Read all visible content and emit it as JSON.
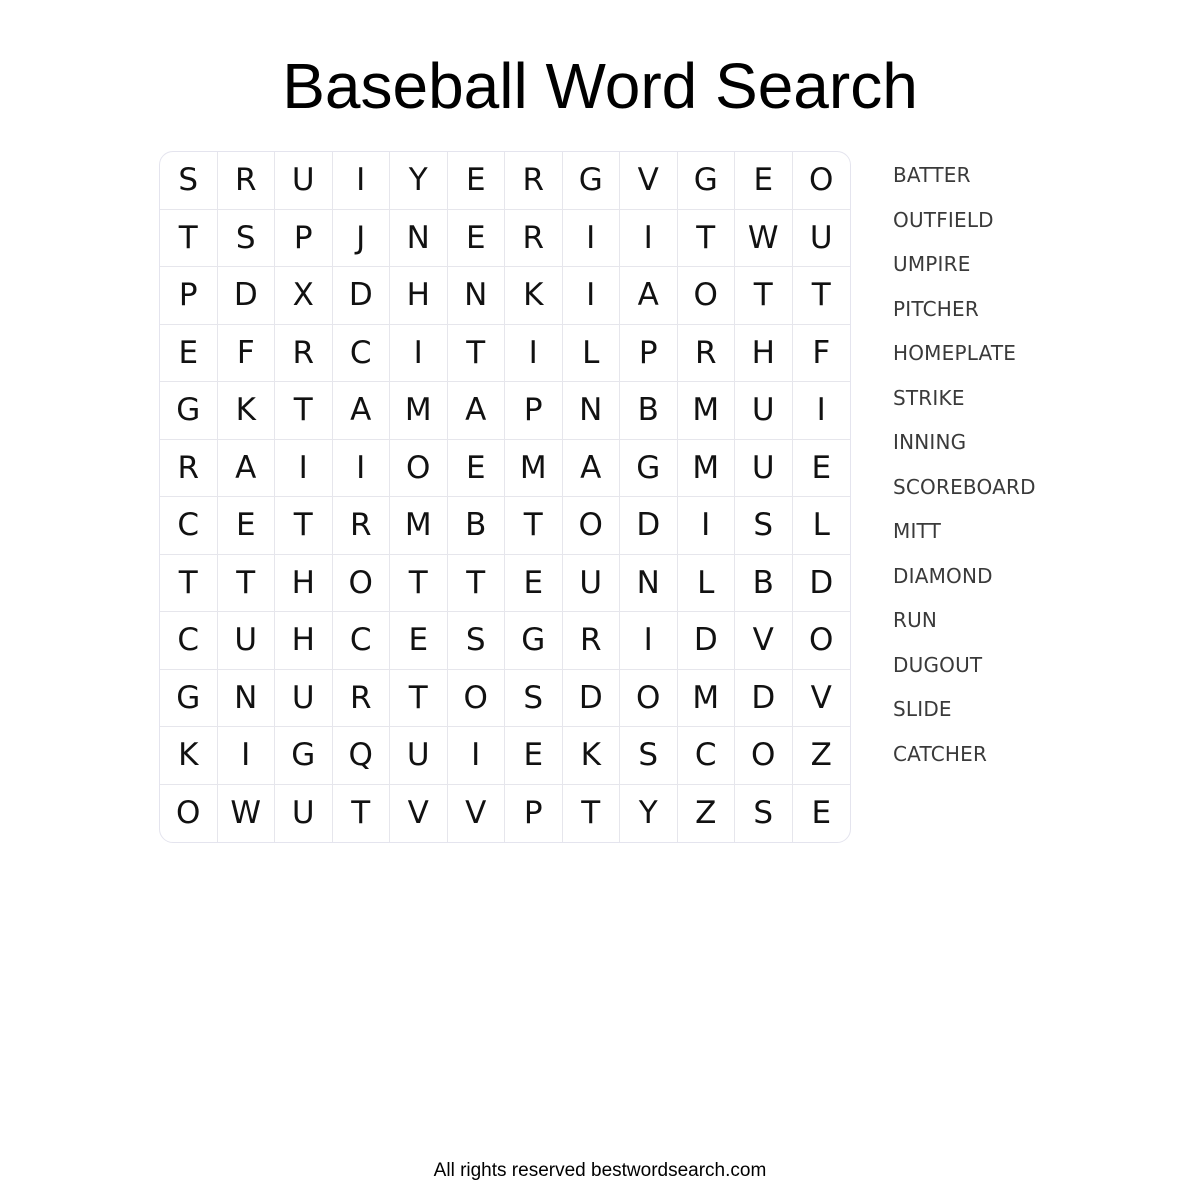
{
  "title": "Baseball Word Search",
  "grid": [
    [
      "S",
      "R",
      "U",
      "I",
      "Y",
      "E",
      "R",
      "G",
      "V",
      "G",
      "E",
      "O"
    ],
    [
      "T",
      "S",
      "P",
      "J",
      "N",
      "E",
      "R",
      "I",
      "I",
      "T",
      "W",
      "U"
    ],
    [
      "P",
      "D",
      "X",
      "D",
      "H",
      "N",
      "K",
      "I",
      "A",
      "O",
      "T",
      "T"
    ],
    [
      "E",
      "F",
      "R",
      "C",
      "I",
      "T",
      "I",
      "L",
      "P",
      "R",
      "H",
      "F"
    ],
    [
      "G",
      "K",
      "T",
      "A",
      "M",
      "A",
      "P",
      "N",
      "B",
      "M",
      "U",
      "I"
    ],
    [
      "R",
      "A",
      "I",
      "I",
      "O",
      "E",
      "M",
      "A",
      "G",
      "M",
      "U",
      "E"
    ],
    [
      "C",
      "E",
      "T",
      "R",
      "M",
      "B",
      "T",
      "O",
      "D",
      "I",
      "S",
      "L"
    ],
    [
      "T",
      "T",
      "H",
      "O",
      "T",
      "T",
      "E",
      "U",
      "N",
      "L",
      "B",
      "D"
    ],
    [
      "C",
      "U",
      "H",
      "C",
      "E",
      "S",
      "G",
      "R",
      "I",
      "D",
      "V",
      "O"
    ],
    [
      "G",
      "N",
      "U",
      "R",
      "T",
      "O",
      "S",
      "D",
      "O",
      "M",
      "D",
      "V"
    ],
    [
      "K",
      "I",
      "G",
      "Q",
      "U",
      "I",
      "E",
      "K",
      "S",
      "C",
      "O",
      "Z"
    ],
    [
      "O",
      "W",
      "U",
      "T",
      "V",
      "V",
      "P",
      "T",
      "Y",
      "Z",
      "S",
      "E"
    ]
  ],
  "words": [
    "BATTER",
    "OUTFIELD",
    "UMPIRE",
    "PITCHER",
    "HOMEPLATE",
    "STRIKE",
    "INNING",
    "SCOREBOARD",
    "MITT",
    "DIAMOND",
    "RUN",
    "DUGOUT",
    "SLIDE",
    "CATCHER"
  ],
  "footer": "All rights reserved bestwordsearch.com"
}
